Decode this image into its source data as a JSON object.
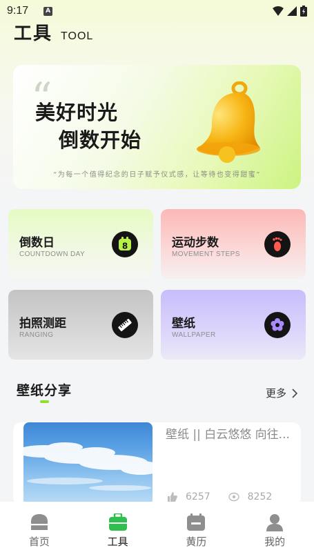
{
  "status_bar": {
    "time": "9:17",
    "indicator": "A",
    "icons": [
      "wifi-icon",
      "signal-icon",
      "battery-icon"
    ]
  },
  "header": {
    "title": "工具",
    "subtitle": "TOOL"
  },
  "banner": {
    "quote_mark": "“",
    "line1": "美好时光",
    "line2": "倒数开始",
    "motto": "“为每一个值得纪念的日子赋予仪式感，让等待也变得甜蜜”",
    "icon": "bell-icon"
  },
  "tools": [
    {
      "title": "倒数日",
      "subtitle": "COUNTDOWN DAY",
      "icon": "calendar-8-icon"
    },
    {
      "title": "运动步数",
      "subtitle": "MOVEMENT STEPS",
      "icon": "footprint-icon"
    },
    {
      "title": "拍照测距",
      "subtitle": "RANGING",
      "icon": "ruler-icon"
    },
    {
      "title": "壁纸",
      "subtitle": "WALLPAPER",
      "icon": "flower-icon"
    }
  ],
  "wallpaper_section": {
    "title": "壁纸分享",
    "more_label": "更多",
    "items": [
      {
        "title": "壁纸 || 白云悠悠 向往...",
        "likes": "6257",
        "views": "8252"
      }
    ]
  },
  "tabbar": {
    "active_index": 1,
    "tabs": [
      {
        "label": "首页",
        "icon": "home-icon"
      },
      {
        "label": "工具",
        "icon": "toolbox-icon"
      },
      {
        "label": "黄历",
        "icon": "almanac-calendar-icon"
      },
      {
        "label": "我的",
        "icon": "profile-icon"
      }
    ]
  },
  "colors": {
    "accent_green": "#8ee02a",
    "bell_gold": "#f7b514",
    "dark_icon": "#141414"
  }
}
